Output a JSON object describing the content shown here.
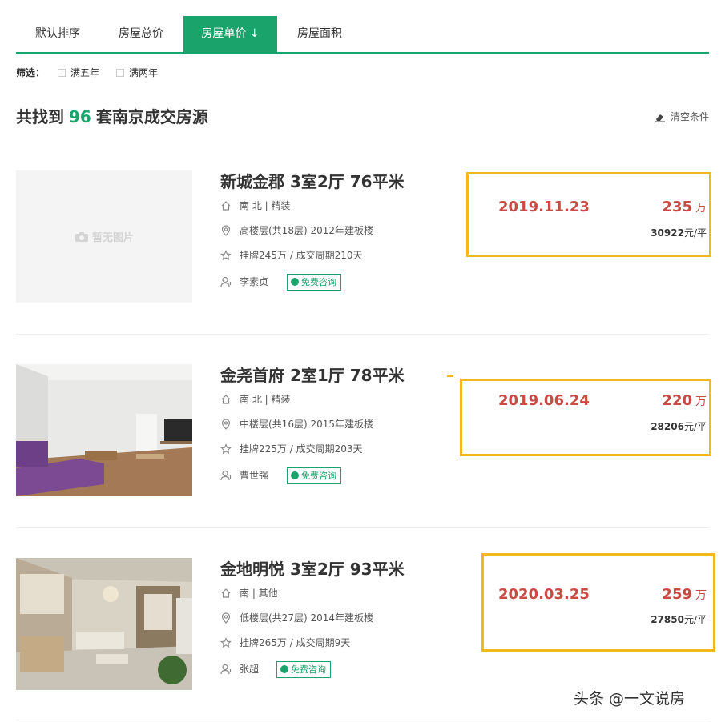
{
  "sort_tabs": [
    {
      "label": "默认排序",
      "active": false
    },
    {
      "label": "房屋总价",
      "active": false
    },
    {
      "label": "房屋单价",
      "active": true,
      "arrow": "↓"
    },
    {
      "label": "房屋面积",
      "active": false
    }
  ],
  "filter": {
    "label": "筛选：",
    "options": [
      "满五年",
      "满两年"
    ]
  },
  "result": {
    "prefix": "共找到",
    "count": "96",
    "suffix": "套南京成交房源"
  },
  "clear_label": "清空条件",
  "listings": [
    {
      "title": "新城金郡 3室2厅 76平米",
      "house_info": "南 北 | 精装",
      "position_info": "高楼层(共18层) 2012年建板楼",
      "deal_info": "挂牌245万 / 成交周期210天",
      "agent": "李素贞",
      "consult_label": "免费咨询",
      "deal_date": "2019.11.23",
      "total_price": "235",
      "price_unit": "万",
      "unit_price_value": "30922",
      "unit_price_suffix": "元/平",
      "photo": "none",
      "no_photo_text": "暂无图片"
    },
    {
      "title": "金尧首府 2室1厅 78平米",
      "house_info": "南 北 | 精装",
      "position_info": "中楼层(共16层) 2015年建板楼",
      "deal_info": "挂牌225万 / 成交周期203天",
      "agent": "曹世强",
      "consult_label": "免费咨询",
      "deal_date": "2019.06.24",
      "total_price": "220",
      "price_unit": "万",
      "unit_price_value": "28206",
      "unit_price_suffix": "元/平",
      "photo": "living-room-purple-sofa"
    },
    {
      "title": "金地明悦 3室2厅 93平米",
      "house_info": "南 | 其他",
      "position_info": "低楼层(共27层) 2014年建板楼",
      "deal_info": "挂牌265万 / 成交周期9天",
      "agent": "张超",
      "consult_label": "免费咨询",
      "deal_date": "2020.03.25",
      "total_price": "259",
      "price_unit": "万",
      "unit_price_value": "27850",
      "unit_price_suffix": "元/平",
      "photo": "living-room-chandelier"
    }
  ],
  "watermark": "头条 @一文说房",
  "colors": {
    "accent": "#1aa36a",
    "price": "#c94b43",
    "highlight_box": "#f2b81e"
  }
}
